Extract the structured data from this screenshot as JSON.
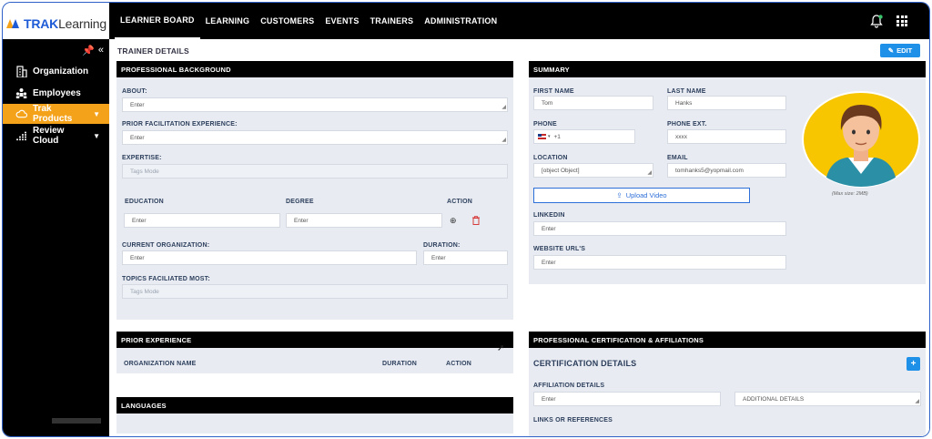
{
  "brand": {
    "name_part1": "TRAK",
    "name_part2": "Learning"
  },
  "topnav": {
    "items": [
      "LEARNER BOARD",
      "LEARNING",
      "CUSTOMERS",
      "EVENTS",
      "TRAINERS",
      "ADMINISTRATION"
    ],
    "active_index": 0
  },
  "sidebar": {
    "items": [
      {
        "label": "Organization",
        "icon": "building-icon"
      },
      {
        "label": "Employees",
        "icon": "people-icon"
      },
      {
        "label": "Trak Products",
        "icon": "cloud-icon",
        "active": true
      },
      {
        "label": "Review Cloud",
        "icon": "dots-icon"
      }
    ]
  },
  "page": {
    "title": "TRAINER DETAILS",
    "edit_label": "EDIT"
  },
  "professional_background": {
    "header": "PROFESSIONAL BACKGROUND",
    "about_label": "ABOUT:",
    "about_placeholder": "Enter",
    "prior_label": "PRIOR FACILITATION EXPERIENCE:",
    "prior_placeholder": "Enter",
    "expertise_label": "EXPERTISE:",
    "expertise_placeholder": "Tags Mode",
    "education_label": "EDUCATION",
    "degree_label": "DEGREE",
    "action_label": "ACTION",
    "education_placeholder": "Enter",
    "degree_placeholder": "Enter",
    "current_org_label": "CURRENT ORGANIZATION:",
    "current_org_placeholder": "Enter",
    "duration_label": "DURATION:",
    "duration_placeholder": "Enter",
    "topics_label": "TOPICS FACILIATED MOST:",
    "topics_placeholder": "Tags Mode"
  },
  "summary": {
    "header": "SUMMARY",
    "first_name_label": "FIRST NAME",
    "first_name_value": "Tom",
    "last_name_label": "LAST NAME",
    "last_name_value": "Hanks",
    "phone_label": "PHONE",
    "phone_code": "+1",
    "phone_ext_label": "PHONE EXT.",
    "phone_ext_value": "xxxx",
    "location_label": "LOCATION",
    "location_value": "[object Object]",
    "email_label": "EMAIL",
    "email_value": "tomhanks5@yopmail.com",
    "upload_label": "Upload Video",
    "linkedin_label": "LINKEDIN",
    "linkedin_placeholder": "Enter",
    "website_label": "WEBSITE URL'S",
    "website_placeholder": "Enter",
    "avatar_caption": "(Max size: 2MB)"
  },
  "prior_experience": {
    "header": "PRIOR EXPERIENCE",
    "columns": [
      "ORGANIZATION NAME",
      "DURATION",
      "ACTION"
    ]
  },
  "languages": {
    "header": "LANGUAGES"
  },
  "certification": {
    "header": "PROFESSIONAL CERTIFICATION & AFFILIATIONS",
    "title": "CERTIFICATION DETAILS",
    "add_label": "+",
    "affiliation_label": "AFFILIATION DETAILS",
    "affiliation_placeholder": "Enter",
    "additional_placeholder": "ADDITIONAL DETAILS",
    "links_label": "LINKS OR REFERENCES"
  },
  "colors": {
    "accent": "#1e90e8",
    "sidebar_active": "#f5a21b",
    "panel_bg": "#e8ecf2",
    "avatar_bg": "#f7c600"
  }
}
